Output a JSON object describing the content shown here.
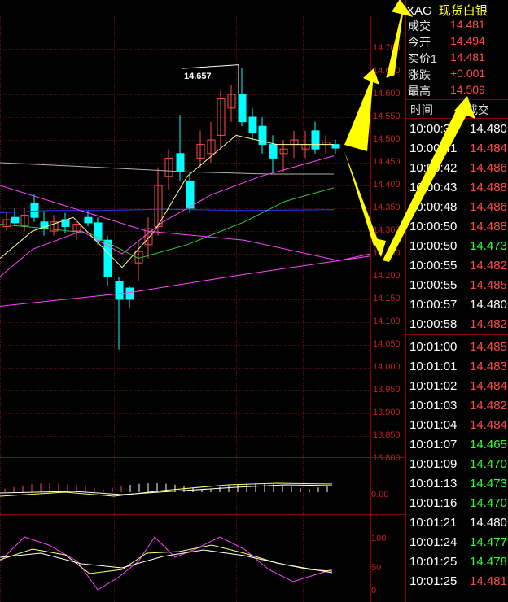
{
  "header": {
    "code": "XAG",
    "name": "现货白银"
  },
  "quote": [
    {
      "label": "成交",
      "value": "14.481"
    },
    {
      "label": "今开",
      "value": "14.494"
    },
    {
      "label": "买价1",
      "value": "14.481"
    },
    {
      "label": "涨跌",
      "value": "+0.001"
    },
    {
      "label": "最高",
      "value": "14.509"
    }
  ],
  "ticks_header": {
    "time": "时间",
    "price": "成交"
  },
  "ticks": [
    {
      "time": "10:00:39",
      "price": "14.480",
      "color": "#ffffff"
    },
    {
      "time": "10:00:41",
      "price": "14.484",
      "color": "#ff4a4a"
    },
    {
      "time": "10:00:42",
      "price": "14.486",
      "color": "#ff4a4a"
    },
    {
      "time": "10:00:43",
      "price": "14.488",
      "color": "#ff4a4a"
    },
    {
      "time": "10:00:48",
      "price": "14.486",
      "color": "#ff4a4a"
    },
    {
      "time": "10:00:50",
      "price": "14.488",
      "color": "#ff4a4a"
    },
    {
      "time": "10:00:50",
      "price": "14.473",
      "color": "#33ff33"
    },
    {
      "time": "10:00:55",
      "price": "14.482",
      "color": "#ff4a4a"
    },
    {
      "time": "10:00:55",
      "price": "14.485",
      "color": "#ff4a4a"
    },
    {
      "time": "10:00:57",
      "price": "14.480",
      "color": "#ffffff"
    },
    {
      "time": "10:00:58",
      "price": "14.482",
      "color": "#ff4a4a"
    },
    {
      "time": "10:01:00",
      "price": "14.485",
      "color": "#ff4a4a"
    },
    {
      "time": "10:01:01",
      "price": "14.483",
      "color": "#ff4a4a"
    },
    {
      "time": "10:01:02",
      "price": "14.484",
      "color": "#ff4a4a"
    },
    {
      "time": "10:01:03",
      "price": "14.482",
      "color": "#ff4a4a"
    },
    {
      "time": "10:01:04",
      "price": "14.484",
      "color": "#ff4a4a"
    },
    {
      "time": "10:01:07",
      "price": "14.465",
      "color": "#33ff33"
    },
    {
      "time": "10:01:09",
      "price": "14.470",
      "color": "#33ff33"
    },
    {
      "time": "10:01:13",
      "price": "14.473",
      "color": "#33ff33"
    },
    {
      "time": "10:01:16",
      "price": "14.470",
      "color": "#33ff33"
    },
    {
      "time": "10:01:21",
      "price": "14.480",
      "color": "#ffffff"
    },
    {
      "time": "10:01:24",
      "price": "14.477",
      "color": "#33ff33"
    },
    {
      "time": "10:01:25",
      "price": "14.478",
      "color": "#33ff33"
    },
    {
      "time": "10:01:25",
      "price": "14.481",
      "color": "#ff4a4a"
    }
  ],
  "price_axis": [
    "14.700",
    "14.650",
    "14.600",
    "14.550",
    "14.500",
    "14.450",
    "14.400",
    "14.350",
    "14.300",
    "14.250",
    "14.200",
    "14.150",
    "14.100",
    "14.050",
    "14.000",
    "13.950",
    "13.900",
    "13.850",
    "13.800"
  ],
  "peak_label": "14.657",
  "macd_axis": "0.00",
  "kdj_axis": [
    "100",
    "50",
    "0"
  ],
  "colors": {
    "up": "#ff4a4a",
    "down": "#00ffff",
    "arrow": "#ffff00",
    "flat": "#ffffff",
    "green": "#33ff33"
  }
}
